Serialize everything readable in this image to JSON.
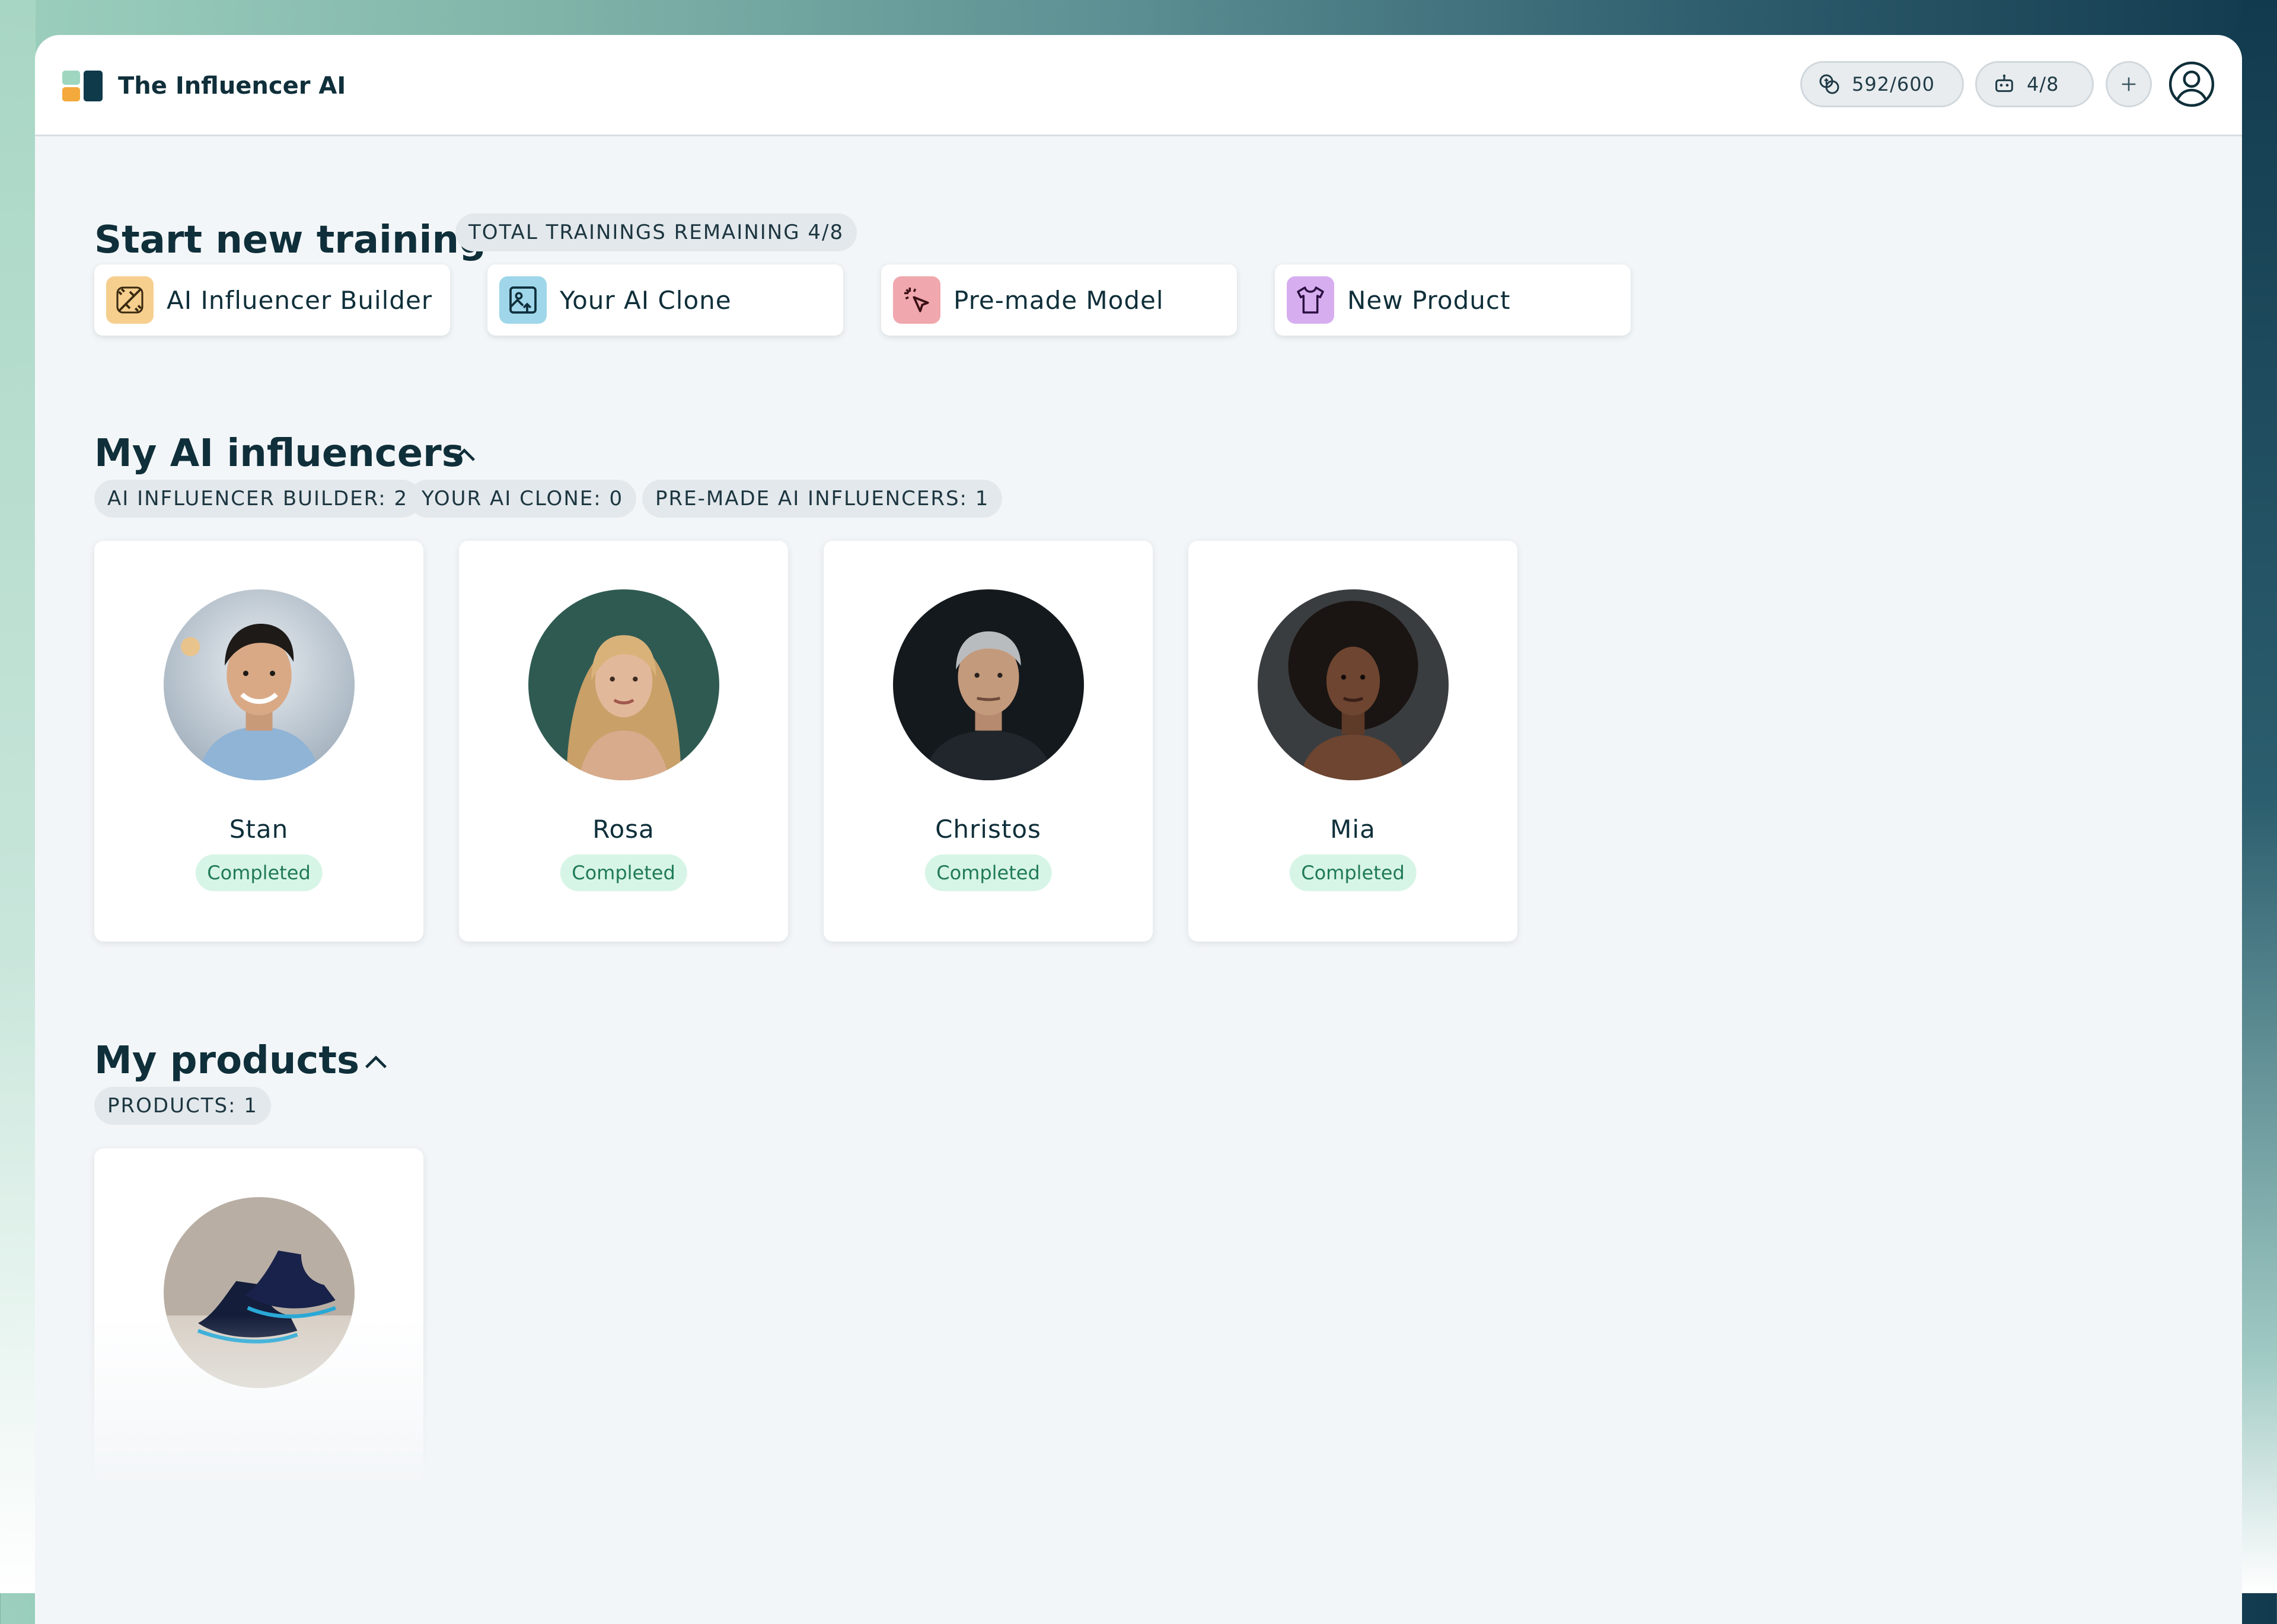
{
  "app": {
    "title": "The Influencer AI",
    "credits": "592/600",
    "models": "4/8"
  },
  "training": {
    "title": "Start new training",
    "remaining_badge": "TOTAL TRAININGS REMAINING 4/8",
    "options": [
      {
        "label": "AI Influencer Builder",
        "icon": "wand-sparkle-icon",
        "color": "#f6cf8f"
      },
      {
        "label": "Your AI Clone",
        "icon": "image-upload-icon",
        "color": "#9fd6ea"
      },
      {
        "label": "Pre-made Model",
        "icon": "cursor-click-icon",
        "color": "#f0a7ad"
      },
      {
        "label": "New Product",
        "icon": "tshirt-icon",
        "color": "#d6aef0"
      }
    ]
  },
  "influencers": {
    "title": "My AI influencers",
    "counts": [
      "AI INFLUENCER BUILDER: 2",
      "YOUR AI CLONE: 0",
      "PRE-MADE AI INFLUENCERS: 1"
    ],
    "items": [
      {
        "name": "Stan",
        "status": "Completed"
      },
      {
        "name": "Rosa",
        "status": "Completed"
      },
      {
        "name": "Christos",
        "status": "Completed"
      },
      {
        "name": "Mia",
        "status": "Completed"
      }
    ]
  },
  "products": {
    "title": "My products",
    "count": "PRODUCTS: 1"
  },
  "colors": {
    "accent_dark": "#0f3a4a",
    "status_bg": "#d7f5e6",
    "status_text": "#1f7a55"
  }
}
